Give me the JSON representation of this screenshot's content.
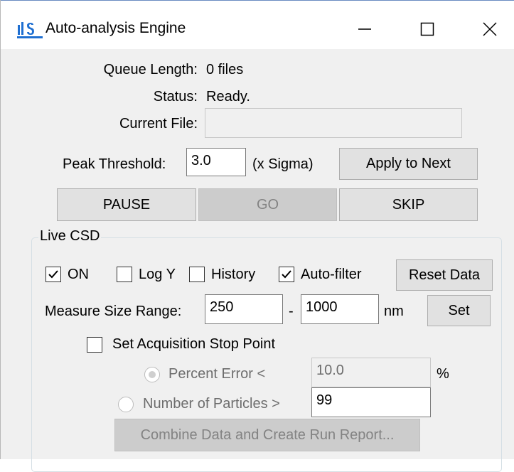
{
  "window": {
    "title": "Auto-analysis Engine",
    "icon": "app-logo-icon",
    "controls": [
      "minimize-icon",
      "maximize-icon",
      "close-icon"
    ]
  },
  "status": {
    "queue_length_label": "Queue Length:",
    "queue_length_value": "0 files",
    "status_label": "Status:",
    "status_value": "Ready.",
    "current_file_label": "Current File:",
    "current_file_value": ""
  },
  "threshold": {
    "label": "Peak Threshold:",
    "value": "3.0",
    "unit": "(x Sigma)",
    "apply_label": "Apply to Next"
  },
  "controls": {
    "pause_label": "PAUSE",
    "go_label": "GO",
    "skip_label": "SKIP"
  },
  "live_csd": {
    "group_title": "Live CSD",
    "on_label": "ON",
    "on_checked": true,
    "logy_label": "Log Y",
    "logy_checked": false,
    "history_label": "History",
    "history_checked": false,
    "autofilter_label": "Auto-filter",
    "autofilter_checked": true,
    "reset_label": "Reset Data",
    "range_label": "Measure Size Range:",
    "range_min": "250",
    "range_sep": "-",
    "range_max": "1000",
    "range_unit": "nm",
    "set_label": "Set",
    "stop_point_label": "Set Acquisition Stop Point",
    "stop_point_checked": false,
    "percent_error_label": "Percent Error <",
    "percent_error_value": "10.0",
    "percent_unit": "%",
    "num_particles_label": "Number of Particles >",
    "num_particles_value": "99",
    "combine_label": "Combine Data and Create Run Report..."
  },
  "colors": {
    "client_bg": "#f0f0f0",
    "button_bg": "#e1e1e1",
    "disabled_button_bg": "#cccccc",
    "logo_blue": "#1f6fd1"
  }
}
